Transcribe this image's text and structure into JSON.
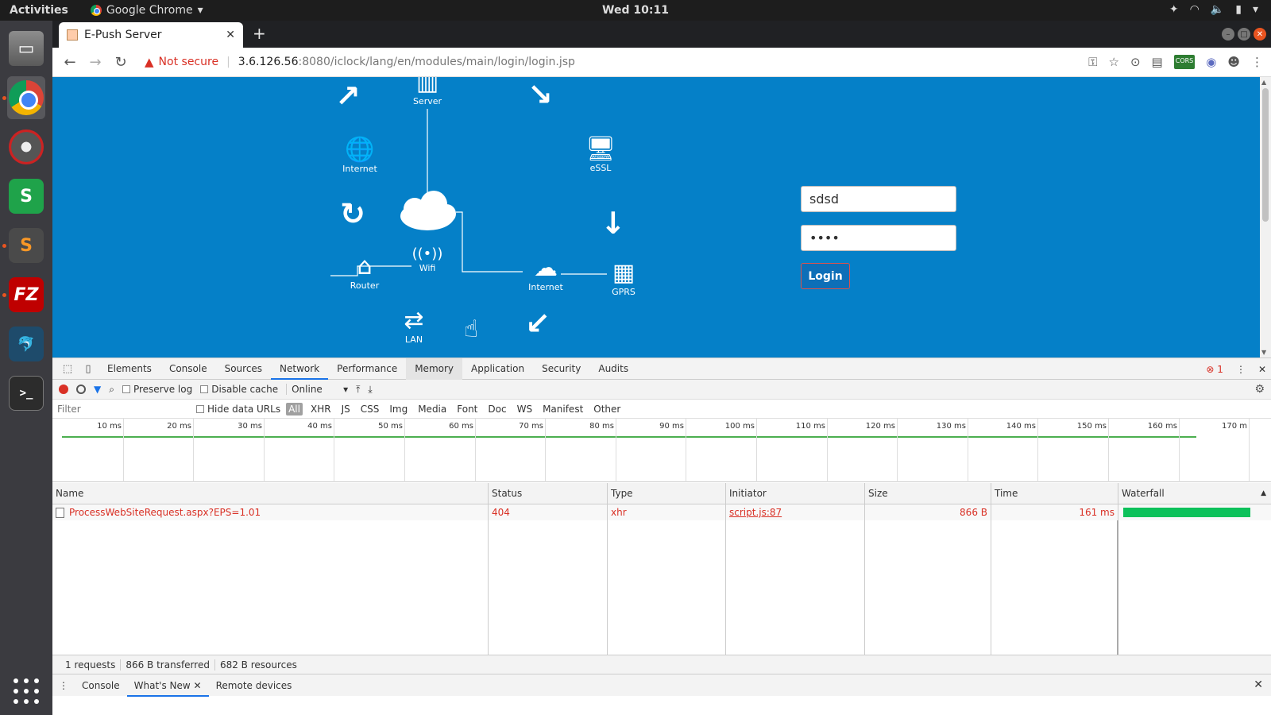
{
  "os": {
    "activities": "Activities",
    "app_name": "Google Chrome",
    "clock": "Wed 10:11"
  },
  "browser": {
    "tab_title": "E-Push Server",
    "security_label": "Not secure",
    "url_host": "3.6.126.56",
    "url_path": ":8080/iclock/lang/en/modules/main/login/login.jsp"
  },
  "page": {
    "diagram_labels": {
      "server": "Server",
      "internet_left": "Internet",
      "essl": "eSSL",
      "wifi": "Wifi",
      "router": "Router",
      "internet_right": "Internet",
      "gprs": "GPRS",
      "lan": "LAN"
    },
    "login": {
      "username_value": "sdsd",
      "password_value": "••••",
      "button_label": "Login"
    }
  },
  "devtools": {
    "tabs": [
      "Elements",
      "Console",
      "Sources",
      "Network",
      "Performance",
      "Memory",
      "Application",
      "Security",
      "Audits"
    ],
    "error_count": "1",
    "toolbar": {
      "preserve_log": "Preserve log",
      "disable_cache": "Disable cache",
      "throttle": "Online"
    },
    "filter": {
      "placeholder": "Filter",
      "hide_data_urls": "Hide data URLs",
      "types": [
        "All",
        "XHR",
        "JS",
        "CSS",
        "Img",
        "Media",
        "Font",
        "Doc",
        "WS",
        "Manifest",
        "Other"
      ]
    },
    "timeline_ticks": [
      "10 ms",
      "20 ms",
      "30 ms",
      "40 ms",
      "50 ms",
      "60 ms",
      "70 ms",
      "80 ms",
      "90 ms",
      "100 ms",
      "110 ms",
      "120 ms",
      "130 ms",
      "140 ms",
      "150 ms",
      "160 ms",
      "170 m"
    ],
    "columns": {
      "name": "Name",
      "status": "Status",
      "type": "Type",
      "initiator": "Initiator",
      "size": "Size",
      "time": "Time",
      "waterfall": "Waterfall"
    },
    "request": {
      "name": "ProcessWebSiteRequest.aspx?EPS=1.01",
      "status": "404",
      "type": "xhr",
      "initiator": "script.js:87",
      "size": "866 B",
      "time": "161 ms"
    },
    "summary": {
      "requests": "1 requests",
      "transferred": "866 B transferred",
      "resources": "682 B resources"
    },
    "drawer": {
      "console": "Console",
      "whats_new": "What's New",
      "remote_devices": "Remote devices"
    }
  }
}
